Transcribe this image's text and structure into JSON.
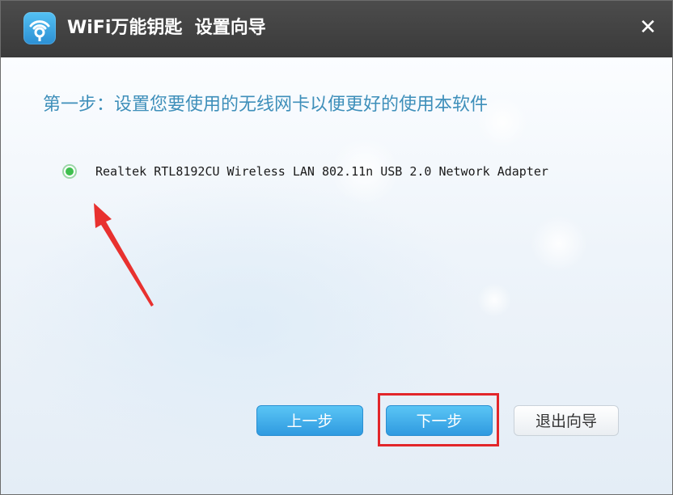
{
  "window": {
    "app_name": "WiFi万能钥匙",
    "dialog_title": "设置向导",
    "close_symbol": "✕"
  },
  "wizard": {
    "step_heading": "第一步：设置您要使用的无线网卡以便更好的使用本软件",
    "adapters": [
      {
        "label": "Realtek RTL8192CU Wireless LAN 802.11n USB 2.0 Network Adapter",
        "selected": true
      }
    ]
  },
  "buttons": {
    "prev_label": "上一步",
    "next_label": "下一步",
    "exit_label": "退出向导"
  },
  "icons": {
    "app": "wifi-key-icon",
    "close": "close-icon",
    "annotation": "red-arrow-annotation"
  },
  "colors": {
    "titlebar": "#3f3f3f",
    "heading": "#3e8fba",
    "primary_button": "#3aa6e8",
    "radio_selected": "#3fbf4f",
    "annotation": "#e2262a"
  }
}
